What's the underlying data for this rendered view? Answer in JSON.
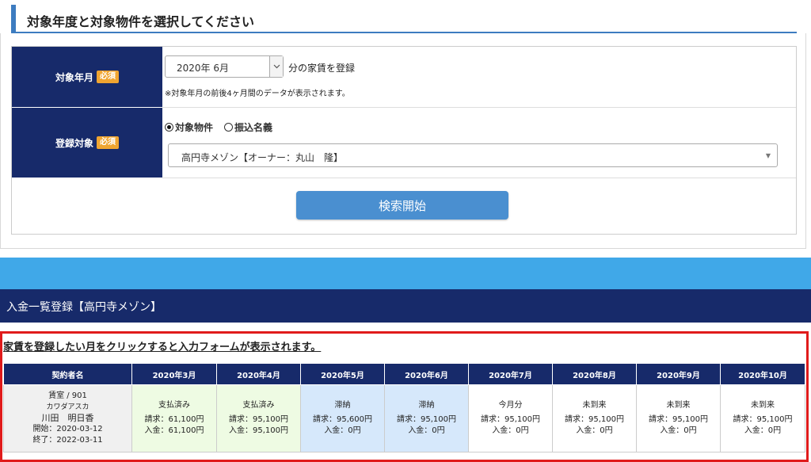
{
  "header": {
    "title": "対象年度と対象物件を選択してください"
  },
  "form": {
    "month_label": "対象年月",
    "required_badge": "必須",
    "month_value": "2020年 6月",
    "month_suffix": "分の家賃を登録",
    "month_note": "※対象年月の前後4ヶ月間のデータが表示されます。",
    "target_label": "登録対象",
    "radio_property": "対象物件",
    "radio_transfer": "振込名義",
    "property_value": "高円寺メゾン【オーナー：丸山　隆】",
    "search_button": "検索開始"
  },
  "list": {
    "title": "入金一覧登録【高円寺メゾン】",
    "instruction": "家賃を登録したい月をクリックすると入力フォームが表示されます。",
    "headers": [
      "契約者名",
      "2020年3月",
      "2020年4月",
      "2020年5月",
      "2020年6月",
      "2020年7月",
      "2020年8月",
      "2020年9月",
      "2020年10月"
    ],
    "tenant": {
      "room": "賃室 / 901",
      "kana": "カワダアスカ",
      "name": "川田　明日香",
      "start": "開始：2020-03-12",
      "end": "終了：2022-03-11"
    },
    "months": [
      {
        "status": "支払済み",
        "billed": "請求：61,100円",
        "paid": "入金：61,100円",
        "state": "paid"
      },
      {
        "status": "支払済み",
        "billed": "請求：95,100円",
        "paid": "入金：95,100円",
        "state": "paid"
      },
      {
        "status": "滞納",
        "billed": "請求：95,600円",
        "paid": "入金：0円",
        "state": "late"
      },
      {
        "status": "滞納",
        "billed": "請求：95,100円",
        "paid": "入金：0円",
        "state": "late"
      },
      {
        "status": "今月分",
        "billed": "請求：95,100円",
        "paid": "入金：0円",
        "state": "other"
      },
      {
        "status": "未到来",
        "billed": "請求：95,100円",
        "paid": "入金：0円",
        "state": "other"
      },
      {
        "status": "未到来",
        "billed": "請求：95,100円",
        "paid": "入金：0円",
        "state": "other"
      },
      {
        "status": "未到来",
        "billed": "請求：95,100円",
        "paid": "入金：0円",
        "state": "other"
      }
    ]
  },
  "colors": {
    "navy": "#172a6a",
    "accent_blue": "#40a8e8",
    "button_blue": "#4a8fd0",
    "badge_orange": "#f0a531",
    "paid_bg": "#eefbe3",
    "late_bg": "#d6e8fb",
    "highlight_red": "#e01b1b"
  },
  "icons": {
    "select_arrow": "chevron-down-icon",
    "radio_selected": "radio-checked-icon",
    "radio_unselected": "radio-unchecked-icon"
  }
}
